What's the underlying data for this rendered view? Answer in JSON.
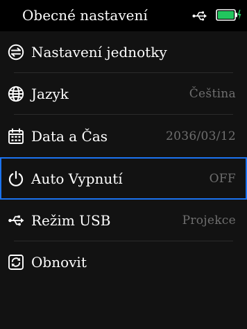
{
  "header": {
    "title": "Obecné nastavení",
    "usb_icon": "usb-icon",
    "battery_icon": "battery-charging-icon",
    "battery_color": "#22c55e",
    "battery_level": 1.0
  },
  "menu": {
    "items": [
      {
        "label": "Nastavení jednotky",
        "value": "",
        "icon": "units-icon"
      },
      {
        "label": "Jazyk",
        "value": "Čeština",
        "icon": "globe-icon"
      },
      {
        "label": "Data a Čas",
        "value": "2036/03/12",
        "icon": "calendar-icon"
      },
      {
        "label": "Auto Vypnutí",
        "value": "OFF",
        "icon": "power-icon",
        "selected": true
      },
      {
        "label": "Režim USB",
        "value": "Projekce",
        "icon": "usb-icon"
      },
      {
        "label": "Obnovit",
        "value": "",
        "icon": "reset-icon"
      }
    ]
  },
  "colors": {
    "background": "#121212",
    "header": "#000000",
    "selection": "#1b73f0",
    "value_text": "#6f6f6f",
    "divider": "#2b2b2b"
  }
}
